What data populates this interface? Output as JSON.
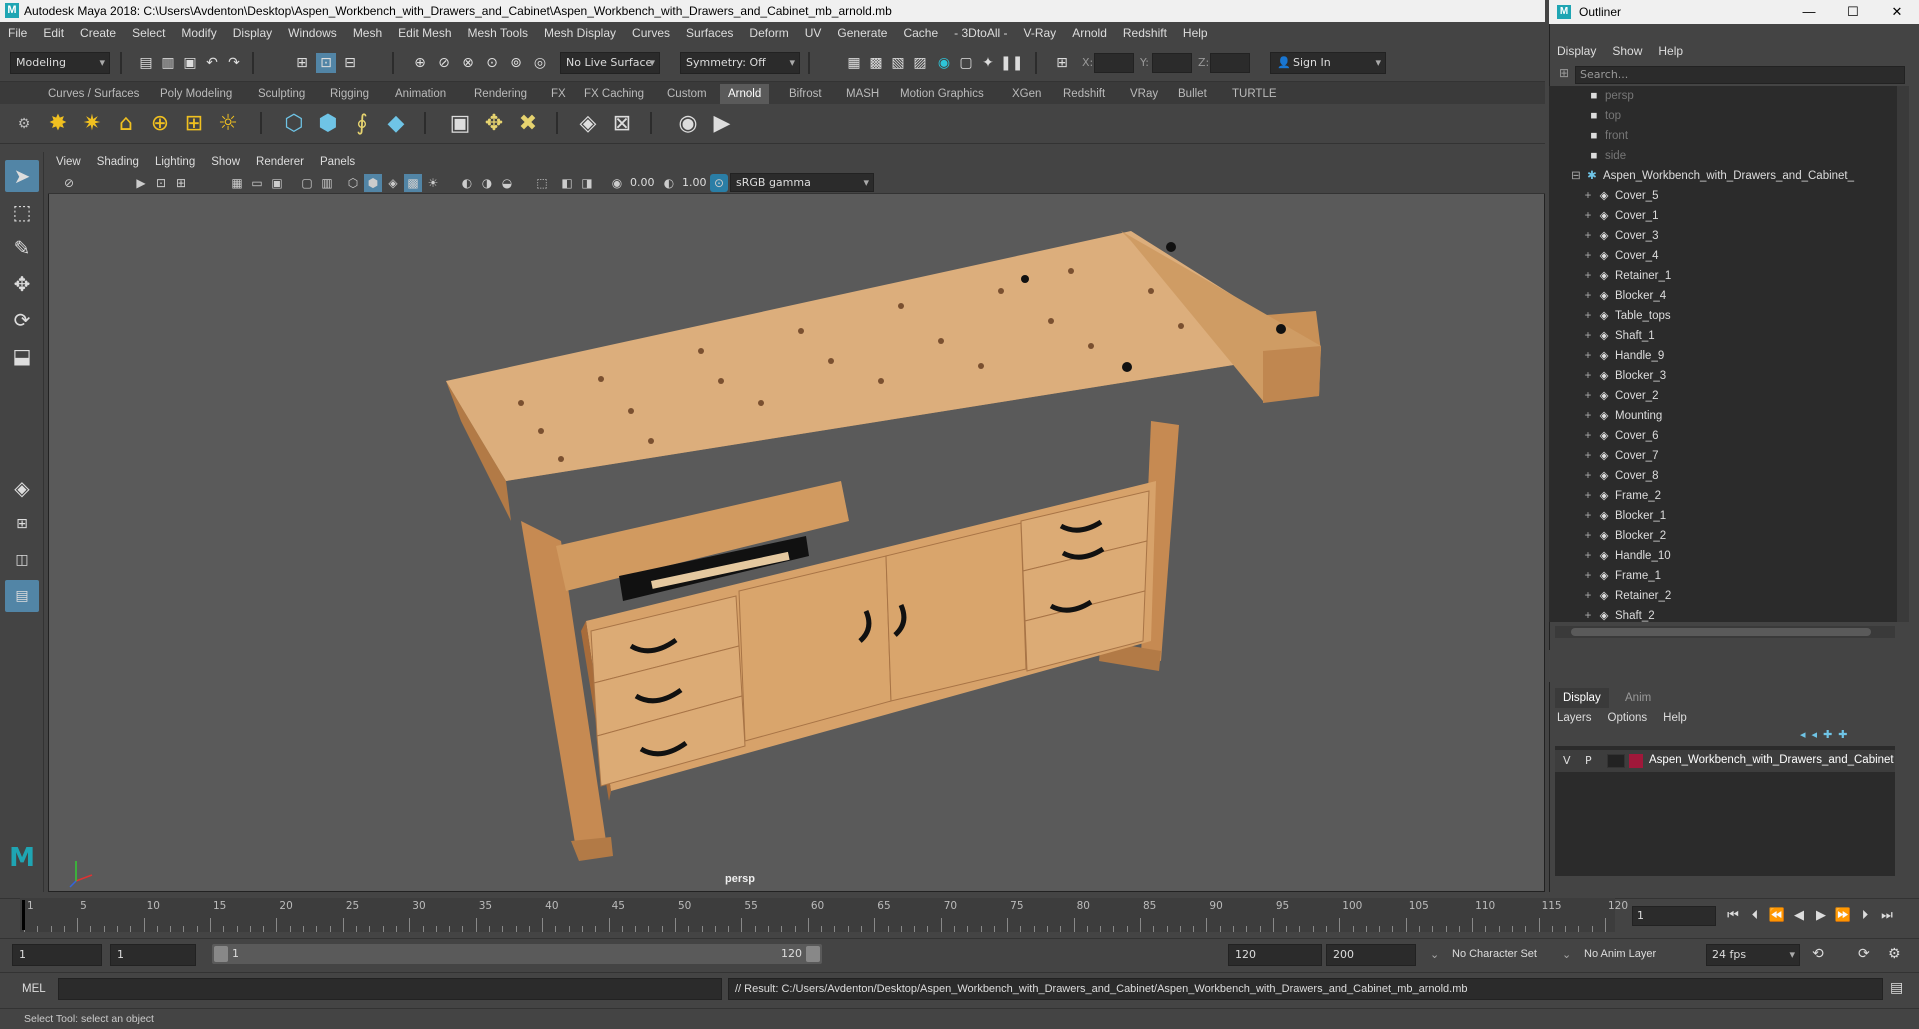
{
  "window": {
    "title": "Autodesk Maya 2018: C:\\Users\\Avdenton\\Desktop\\Aspen_Workbench_with_Drawers_and_Cabinet\\Aspen_Workbench_with_Drawers_and_Cabinet_mb_arnold.mb",
    "logo": "M"
  },
  "menu": [
    "File",
    "Edit",
    "Create",
    "Select",
    "Modify",
    "Display",
    "Windows",
    "Mesh",
    "Edit Mesh",
    "Mesh Tools",
    "Mesh Display",
    "Curves",
    "Surfaces",
    "Deform",
    "UV",
    "Generate",
    "Cache",
    "- 3DtoAll -",
    "V-Ray",
    "Arnold",
    "Redshift",
    "Help"
  ],
  "statusline": {
    "menuset": "Modeling",
    "live_surface": "No Live Surface",
    "symmetry": "Symmetry: Off",
    "x_label": "X:",
    "y_label": "Y:",
    "z_label": "Z:",
    "sign_in": "Sign In"
  },
  "shelf": {
    "tabs": [
      "Curves / Surfaces",
      "Poly Modeling",
      "Sculpting",
      "Rigging",
      "Animation",
      "Rendering",
      "FX",
      "FX Caching",
      "Custom",
      "Arnold",
      "Bifrost",
      "MASH",
      "Motion Graphics",
      "XGen",
      "Redshift",
      "VRay",
      "Bullet",
      "TURTLE"
    ],
    "active_tab": "Arnold"
  },
  "viewport": {
    "menu": [
      "View",
      "Shading",
      "Lighting",
      "Show",
      "Renderer",
      "Panels"
    ],
    "exposure": "0.00",
    "gamma": "1.00",
    "colorspace": "sRGB gamma",
    "camera_label": "persp"
  },
  "outliner": {
    "title": "Outliner",
    "menu": [
      "Display",
      "Show",
      "Help"
    ],
    "search_placeholder": "Search...",
    "cameras": [
      "persp",
      "top",
      "front",
      "side"
    ],
    "root": "Aspen_Workbench_with_Drawers_and_Cabinet_",
    "children": [
      "Cover_5",
      "Cover_1",
      "Cover_3",
      "Cover_4",
      "Retainer_1",
      "Blocker_4",
      "Table_tops",
      "Shaft_1",
      "Handle_9",
      "Blocker_3",
      "Cover_2",
      "Mounting",
      "Cover_6",
      "Cover_7",
      "Cover_8",
      "Frame_2",
      "Blocker_1",
      "Blocker_2",
      "Handle_10",
      "Frame_1",
      "Retainer_2",
      "Shaft_2"
    ]
  },
  "layer_editor": {
    "tabs": [
      "Display",
      "Anim"
    ],
    "active_tab": "Display",
    "menu": [
      "Layers",
      "Options",
      "Help"
    ],
    "layer": {
      "v": "V",
      "p": "P",
      "name": "Aspen_Workbench_with_Drawers_and_Cabinet",
      "color": "#a0183a"
    }
  },
  "timeline": {
    "ticks": [
      "1",
      "5",
      "10",
      "15",
      "20",
      "25",
      "30",
      "35",
      "40",
      "45",
      "50",
      "55",
      "60",
      "65",
      "70",
      "75",
      "80",
      "85",
      "90",
      "95",
      "100",
      "105",
      "110",
      "115",
      "120"
    ],
    "current_frame": "1"
  },
  "range": {
    "start": "1",
    "playback_start": "1",
    "slider_start": "1",
    "slider_end": "120",
    "playback_end": "120",
    "end": "200",
    "character_set": "No Character Set",
    "anim_layer": "No Anim Layer",
    "fps": "24 fps"
  },
  "command": {
    "language": "MEL",
    "result": "// Result: C:/Users/Avdenton/Desktop/Aspen_Workbench_with_Drawers_and_Cabinet/Aspen_Workbench_with_Drawers_and_Cabinet_mb_arnold.mb"
  },
  "help_line": "Select Tool: select an object",
  "colors": {
    "accent": "#5285a6",
    "maya_logo": "#1fa5b3",
    "wood": "#d9a56c"
  }
}
